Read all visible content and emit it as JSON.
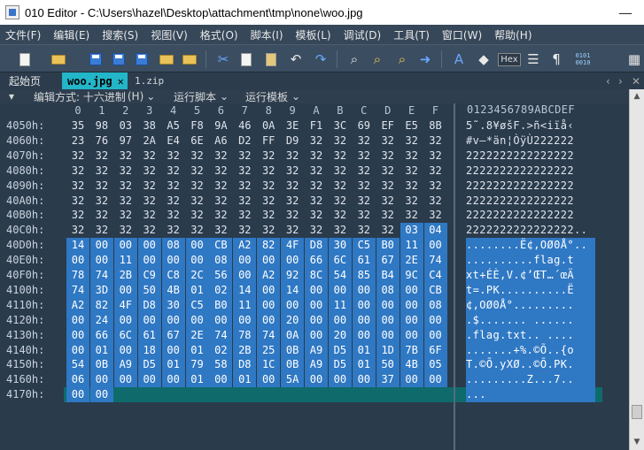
{
  "window": {
    "title": "010 Editor - C:\\Users\\hazel\\Desktop\\attachment\\tmp\\none\\woo.jpg"
  },
  "menu": [
    "文件(F)",
    "编辑(E)",
    "搜索(S)",
    "视图(V)",
    "格式(O)",
    "脚本(I)",
    "模板(L)",
    "调试(D)",
    "工具(T)",
    "窗口(W)",
    "帮助(H)"
  ],
  "toolbar": {
    "icons": [
      "new-file-icon",
      "open-folder-icon",
      "save-icon",
      "save-as-icon",
      "save-all-icon",
      "open-dir-icon",
      "workspace-icon",
      "cut-icon",
      "copy-icon",
      "paste-icon",
      "undo-icon",
      "redo-icon",
      "find-icon",
      "find-replace-icon",
      "find-in-files-icon",
      "goto-icon",
      "font-icon",
      "highlight-icon",
      "hex-view-icon",
      "edit-as-icon",
      "paragraph-icon",
      "binary-view-icon",
      "calculator-icon"
    ],
    "hex_label": "Hex",
    "bin_label": "0101\n0010"
  },
  "tabs": {
    "start": "起始页",
    "active": "woo.jpg",
    "active_close": "✕",
    "other": "1.zip"
  },
  "options": {
    "edit_mode": "编辑方式: 十六进制",
    "edit_mode_suffix": "(H)",
    "run_script": "运行脚本",
    "run_template": "运行模板"
  },
  "hex": {
    "columns": [
      "0",
      "1",
      "2",
      "3",
      "4",
      "5",
      "6",
      "7",
      "8",
      "9",
      "A",
      "B",
      "C",
      "D",
      "E",
      "F"
    ],
    "ascii_header": "0123456789ABCDEF",
    "rows": [
      {
        "addr": "4050h:",
        "bytes": [
          "35",
          "98",
          "03",
          "38",
          "A5",
          "F8",
          "9A",
          "46",
          "0A",
          "3E",
          "F1",
          "3C",
          "69",
          "EF",
          "E5",
          "8B"
        ],
        "ascii": "5˜.8¥øšF.>ñ<iïå‹",
        "sel_from": 16,
        "ascii_sel": false
      },
      {
        "addr": "4060h:",
        "bytes": [
          "23",
          "76",
          "97",
          "2A",
          "E4",
          "6E",
          "A6",
          "D2",
          "FF",
          "D9",
          "32",
          "32",
          "32",
          "32",
          "32",
          "32"
        ],
        "ascii": "#v—*än¦ÒÿÙ222222",
        "sel_from": 16,
        "ascii_sel": false
      },
      {
        "addr": "4070h:",
        "bytes": [
          "32",
          "32",
          "32",
          "32",
          "32",
          "32",
          "32",
          "32",
          "32",
          "32",
          "32",
          "32",
          "32",
          "32",
          "32",
          "32"
        ],
        "ascii": "2222222222222222",
        "sel_from": 16,
        "ascii_sel": false
      },
      {
        "addr": "4080h:",
        "bytes": [
          "32",
          "32",
          "32",
          "32",
          "32",
          "32",
          "32",
          "32",
          "32",
          "32",
          "32",
          "32",
          "32",
          "32",
          "32",
          "32"
        ],
        "ascii": "2222222222222222",
        "sel_from": 16,
        "ascii_sel": false
      },
      {
        "addr": "4090h:",
        "bytes": [
          "32",
          "32",
          "32",
          "32",
          "32",
          "32",
          "32",
          "32",
          "32",
          "32",
          "32",
          "32",
          "32",
          "32",
          "32",
          "32"
        ],
        "ascii": "2222222222222222",
        "sel_from": 16,
        "ascii_sel": false
      },
      {
        "addr": "40A0h:",
        "bytes": [
          "32",
          "32",
          "32",
          "32",
          "32",
          "32",
          "32",
          "32",
          "32",
          "32",
          "32",
          "32",
          "32",
          "32",
          "32",
          "32"
        ],
        "ascii": "2222222222222222",
        "sel_from": 16,
        "ascii_sel": false
      },
      {
        "addr": "40B0h:",
        "bytes": [
          "32",
          "32",
          "32",
          "32",
          "32",
          "32",
          "32",
          "32",
          "32",
          "32",
          "32",
          "32",
          "32",
          "32",
          "32",
          "32"
        ],
        "ascii": "2222222222222222",
        "sel_from": 16,
        "ascii_sel": false
      },
      {
        "addr": "40C0h:",
        "bytes": [
          "32",
          "32",
          "32",
          "32",
          "32",
          "32",
          "32",
          "32",
          "32",
          "32",
          "32",
          "32",
          "32",
          "32",
          "03",
          "04"
        ],
        "ascii": "2222222222222222..",
        "sel_from": 14,
        "ascii_sel": false
      },
      {
        "addr": "40D0h:",
        "bytes": [
          "14",
          "00",
          "00",
          "00",
          "08",
          "00",
          "CB",
          "A2",
          "82",
          "4F",
          "D8",
          "30",
          "C5",
          "B0",
          "11",
          "00"
        ],
        "ascii": "........Ë¢‚OØ0Å°..",
        "sel_from": 0,
        "ascii_sel": true
      },
      {
        "addr": "40E0h:",
        "bytes": [
          "00",
          "00",
          "11",
          "00",
          "00",
          "00",
          "08",
          "00",
          "00",
          "00",
          "66",
          "6C",
          "61",
          "67",
          "2E",
          "74"
        ],
        "ascii": "..........flag.t",
        "sel_from": 0,
        "ascii_sel": true
      },
      {
        "addr": "40F0h:",
        "bytes": [
          "78",
          "74",
          "2B",
          "C9",
          "C8",
          "2C",
          "56",
          "00",
          "A2",
          "92",
          "8C",
          "54",
          "85",
          "B4",
          "9C",
          "C4"
        ],
        "ascii": "xt+ÉÈ,V.¢’ŒT…´œÄ",
        "sel_from": 0,
        "ascii_sel": true
      },
      {
        "addr": "4100h:",
        "bytes": [
          "74",
          "3D",
          "00",
          "50",
          "4B",
          "01",
          "02",
          "14",
          "00",
          "14",
          "00",
          "00",
          "00",
          "08",
          "00",
          "CB"
        ],
        "ascii": "t=.PK..........Ë",
        "sel_from": 0,
        "ascii_sel": true
      },
      {
        "addr": "4110h:",
        "bytes": [
          "A2",
          "82",
          "4F",
          "D8",
          "30",
          "C5",
          "B0",
          "11",
          "00",
          "00",
          "00",
          "11",
          "00",
          "00",
          "00",
          "08"
        ],
        "ascii": "¢‚OØ0Å°.........",
        "sel_from": 0,
        "ascii_sel": true
      },
      {
        "addr": "4120h:",
        "bytes": [
          "00",
          "24",
          "00",
          "00",
          "00",
          "00",
          "00",
          "00",
          "00",
          "20",
          "00",
          "00",
          "00",
          "00",
          "00",
          "00"
        ],
        "ascii": ".$....... ......",
        "sel_from": 0,
        "ascii_sel": true
      },
      {
        "addr": "4130h:",
        "bytes": [
          "00",
          "66",
          "6C",
          "61",
          "67",
          "2E",
          "74",
          "78",
          "74",
          "0A",
          "00",
          "20",
          "00",
          "00",
          "00",
          "00"
        ],
        "ascii": ".flag.txt.. ....",
        "sel_from": 0,
        "ascii_sel": true
      },
      {
        "addr": "4140h:",
        "bytes": [
          "00",
          "01",
          "00",
          "18",
          "00",
          "01",
          "02",
          "2B",
          "25",
          "0B",
          "A9",
          "D5",
          "01",
          "1D",
          "7B",
          "6F"
        ],
        "ascii": ".......+%.©Õ..{o",
        "sel_from": 0,
        "ascii_sel": true
      },
      {
        "addr": "4150h:",
        "bytes": [
          "54",
          "0B",
          "A9",
          "D5",
          "01",
          "79",
          "58",
          "D8",
          "1C",
          "0B",
          "A9",
          "D5",
          "01",
          "50",
          "4B",
          "05"
        ],
        "ascii": "T.©Õ.yXØ..©Õ.PK.",
        "sel_from": 0,
        "ascii_sel": true
      },
      {
        "addr": "4160h:",
        "bytes": [
          "06",
          "00",
          "00",
          "00",
          "00",
          "01",
          "00",
          "01",
          "00",
          "5A",
          "00",
          "00",
          "00",
          "37",
          "00",
          "00"
        ],
        "ascii": ".........Z...7..",
        "sel_from": 0,
        "ascii_sel": true
      },
      {
        "addr": "4170h:",
        "bytes": [
          "00",
          "00",
          "",
          "",
          "",
          "",
          "",
          "",
          "",
          "",
          "",
          "",
          "",
          "",
          "",
          ""
        ],
        "ascii": "...",
        "sel_from": 0,
        "ascii_sel": true
      }
    ]
  },
  "scrollbar": {
    "up": "▲",
    "down": "▼"
  },
  "colors": {
    "selection": "#2f78c4",
    "cursor_row": "#0f6b6b",
    "active_tab": "#23b5c8",
    "background": "#2a3b4c"
  }
}
